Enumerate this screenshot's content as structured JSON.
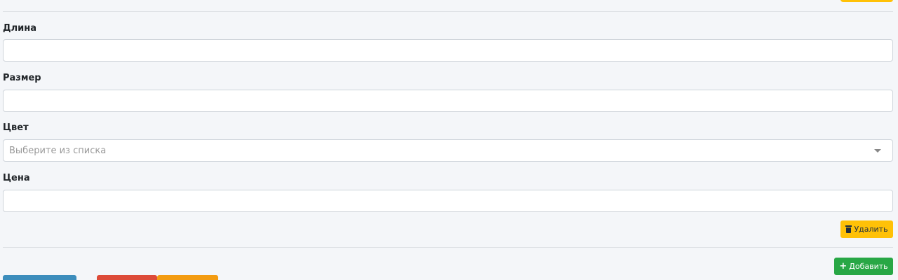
{
  "fields": [
    {
      "label": "Длина",
      "value": ""
    },
    {
      "label": "Размер",
      "value": ""
    },
    {
      "label": "Цвет",
      "placeholder": "Выберите из списка"
    },
    {
      "label": "Цена",
      "value": ""
    }
  ],
  "actions": {
    "delete_label": "Удалить",
    "add_label": "Добавить"
  },
  "colors": {
    "background": "#f4f6f9",
    "warning": "#ffc107",
    "success": "#28a745",
    "primary": "#3c8dbc",
    "danger": "#dd4b39",
    "orange": "#f39c12"
  },
  "icons": {
    "delete": "trash-icon",
    "add": "plus-icon",
    "select": "chevron-down-icon"
  }
}
